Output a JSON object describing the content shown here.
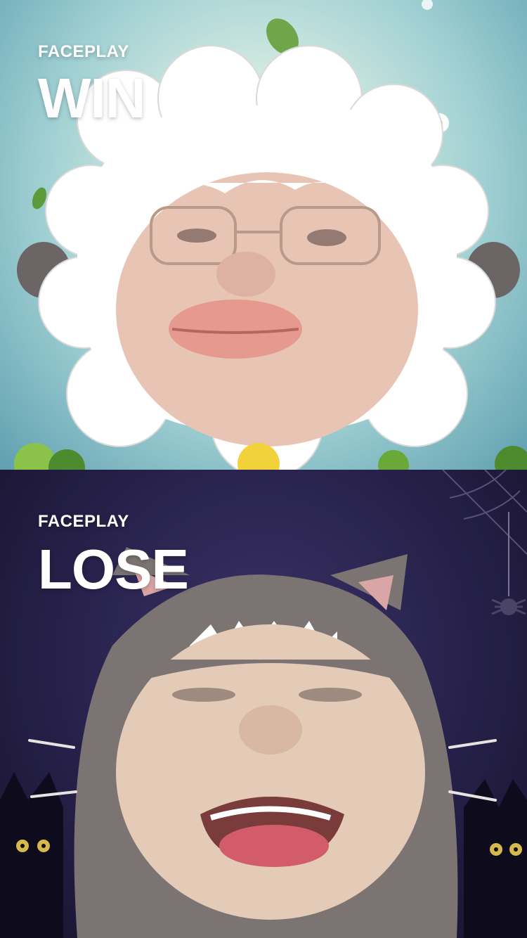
{
  "win_panel": {
    "brand": "FACEPLAY",
    "result": "WIN",
    "costume": "sheep-face-filter",
    "colors": {
      "background": "#9fcfd2",
      "wool": "#ffffff",
      "ears": "#6b6566"
    }
  },
  "lose_panel": {
    "brand": "FACEPLAY",
    "result": "LOSE",
    "costume": "gray-cat-face-filter",
    "colors": {
      "background": "#2a2450",
      "hood": "#7c7472",
      "ear_inner": "#d9a5a5"
    }
  }
}
